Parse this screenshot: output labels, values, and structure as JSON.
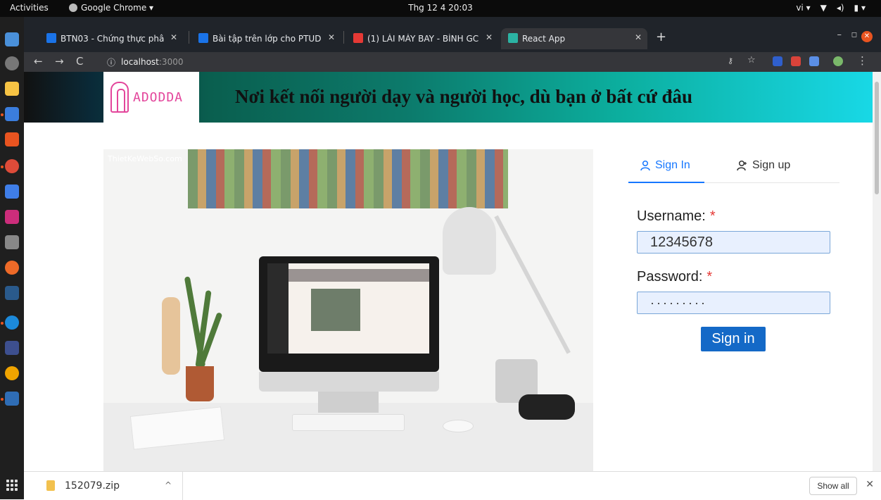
{
  "topbar": {
    "activities": "Activities",
    "app": "Google Chrome ▾",
    "clock": "Thg 12 4  20:03",
    "lang": "vi ▾"
  },
  "tabs": [
    {
      "title": "BTN03 - Chứng thực phâ",
      "favicon_color": "#1a73e8"
    },
    {
      "title": "Bài tập trên lớp cho PTUD",
      "favicon_color": "#1a73e8"
    },
    {
      "title": "(1) LÁI MÁY BAY - BÌNH GC",
      "favicon_color": "#e53935"
    },
    {
      "title": "React App",
      "favicon_color": "#2bb3a3"
    }
  ],
  "address": {
    "host": "localhost",
    "port": ":3000"
  },
  "banner": {
    "logo_text": "ADODDA",
    "slogan": "Nơi kết nối người dạy và người học, dù bạn ở bất cứ đâu"
  },
  "hero": {
    "watermark": "ThietKeWebSo.com"
  },
  "auth": {
    "tab_signin": "Sign In",
    "tab_signup": "Sign up",
    "username_label": "Username:",
    "username_value": "12345678",
    "password_label": "Password:",
    "password_value": "·········",
    "required_mark": "*",
    "submit": "Sign in",
    "accent_color": "#1677ff"
  },
  "downloads": {
    "file": "152079.zip",
    "show_all": "Show all"
  }
}
